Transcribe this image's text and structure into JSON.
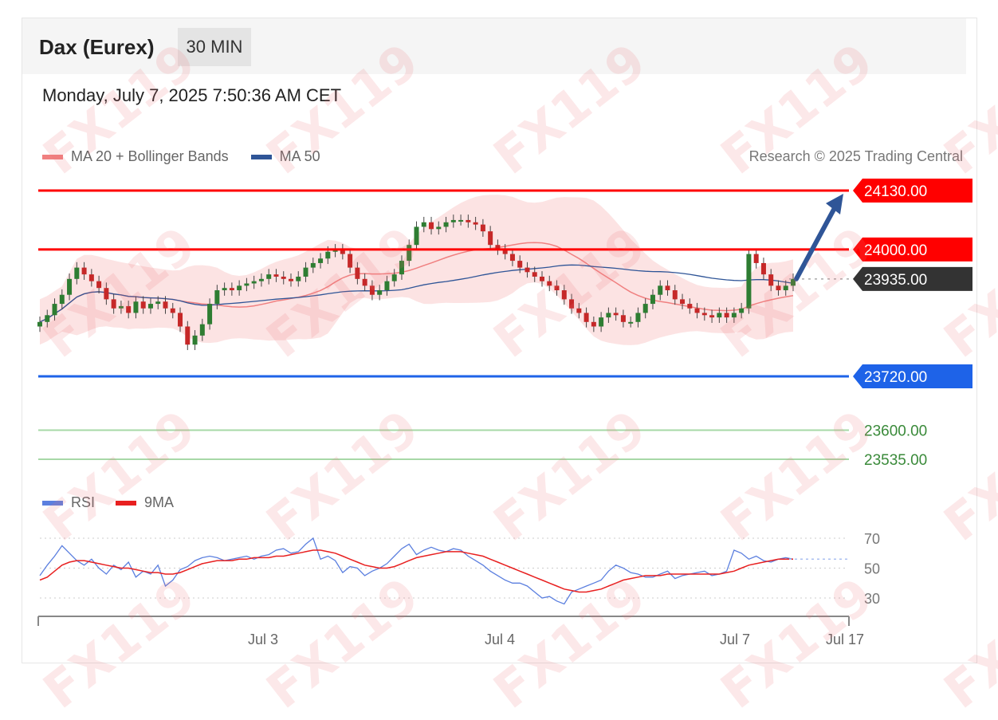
{
  "header": {
    "instrument": "Dax (Eurex)",
    "period": "30 MIN",
    "timestamp": "Monday, July 7, 2025 7:50:36 AM CET"
  },
  "legend_main": [
    {
      "label": "MA 20 + Bollinger Bands",
      "color": "#f08080"
    },
    {
      "label": "MA 50",
      "color": "#2f5597"
    }
  ],
  "legend_rsi": [
    {
      "label": "RSI",
      "color": "#5b7fdf"
    },
    {
      "label": "9MA",
      "color": "#e82020"
    }
  ],
  "credit": "Research © 2025 Trading Central",
  "watermark": "FX119",
  "colors": {
    "resistance": "#ff0000",
    "support": "#1e63e8",
    "target": "#3a8a3a",
    "last": "#333333",
    "arrow": "#2f5597",
    "bullish": "#2e7d32",
    "bearish": "#c62828"
  },
  "chart_data": [
    {
      "type": "candlestick",
      "title": "Dax (Eurex)",
      "timeframe": "30 MIN",
      "x_ticks": [
        "Jul 3",
        "Jul 4",
        "Jul 7",
        "Jul 17"
      ],
      "ylim": [
        23460,
        24170
      ],
      "levels": [
        {
          "value": 24130.0,
          "label": "24130.00",
          "kind": "resistance"
        },
        {
          "value": 24000.0,
          "label": "24000.00",
          "kind": "resistance"
        },
        {
          "value": 23935.0,
          "label": "23935.00",
          "kind": "last"
        },
        {
          "value": 23720.0,
          "label": "23720.00",
          "kind": "support"
        },
        {
          "value": 23600.0,
          "label": "23600.00",
          "kind": "target"
        },
        {
          "value": 23535.0,
          "label": "23535.00",
          "kind": "target"
        }
      ],
      "forecast_arrow": {
        "from": 23935,
        "to": 24130
      },
      "close_series_approx": [
        23840,
        23855,
        23880,
        23900,
        23935,
        23960,
        23945,
        23930,
        23915,
        23890,
        23870,
        23875,
        23860,
        23885,
        23870,
        23880,
        23885,
        23870,
        23860,
        23830,
        23790,
        23810,
        23835,
        23880,
        23910,
        23915,
        23910,
        23920,
        23925,
        23930,
        23935,
        23945,
        23940,
        23935,
        23930,
        23940,
        23960,
        23970,
        23980,
        23995,
        24000,
        23990,
        23960,
        23935,
        23920,
        23900,
        23910,
        23930,
        23945,
        23975,
        24010,
        24050,
        24060,
        24045,
        24050,
        24060,
        24065,
        24065,
        24060,
        24055,
        24040,
        24010,
        24000,
        23990,
        23975,
        23960,
        23950,
        23940,
        23930,
        23920,
        23910,
        23890,
        23870,
        23860,
        23840,
        23830,
        23850,
        23860,
        23855,
        23840,
        23840,
        23860,
        23880,
        23900,
        23920,
        23910,
        23890,
        23880,
        23870,
        23860,
        23855,
        23850,
        23860,
        23850,
        23860,
        23870,
        23990,
        23970,
        23945,
        23920,
        23910,
        23920,
        23935
      ]
    },
    {
      "type": "line",
      "title": "RSI",
      "series": [
        {
          "name": "RSI"
        },
        {
          "name": "9MA"
        }
      ],
      "ylim": [
        20,
        75
      ],
      "y_ticks": [
        70,
        50,
        30
      ],
      "rsi_values": [
        45,
        52,
        58,
        65,
        60,
        55,
        52,
        56,
        50,
        46,
        52,
        49,
        54,
        44,
        48,
        46,
        52,
        38,
        42,
        49,
        51,
        55,
        57,
        58,
        57,
        55,
        56,
        57,
        58,
        56,
        58,
        59,
        62,
        63,
        60,
        61,
        66,
        70,
        56,
        58,
        55,
        47,
        51,
        50,
        45,
        48,
        50,
        53,
        58,
        63,
        66,
        59,
        62,
        64,
        62,
        61,
        63,
        62,
        58,
        55,
        52,
        48,
        45,
        42,
        40,
        40,
        38,
        34,
        30,
        31,
        28,
        26,
        34,
        36,
        38,
        40,
        42,
        48,
        52,
        50,
        47,
        46,
        44,
        44,
        46,
        48,
        43,
        45,
        46,
        47,
        48,
        45,
        46,
        48,
        62,
        60,
        56,
        58,
        55,
        54,
        56,
        57,
        56
      ],
      "ma_values": [
        42,
        44,
        48,
        52,
        54,
        55,
        55,
        54,
        53,
        52,
        51,
        50,
        50,
        49,
        48,
        47,
        47,
        46,
        46,
        47,
        49,
        51,
        53,
        54,
        55,
        55,
        55,
        56,
        56,
        57,
        57,
        57,
        58,
        58,
        59,
        60,
        61,
        62,
        62,
        61,
        60,
        58,
        56,
        54,
        52,
        51,
        50,
        50,
        51,
        53,
        55,
        57,
        58,
        59,
        60,
        61,
        61,
        61,
        60,
        59,
        58,
        56,
        54,
        52,
        50,
        48,
        46,
        44,
        42,
        40,
        38,
        36,
        35,
        34,
        34,
        35,
        36,
        38,
        40,
        42,
        43,
        44,
        45,
        45,
        45,
        46,
        46,
        46,
        46,
        46,
        46,
        46,
        46,
        47,
        48,
        50,
        52,
        53,
        54,
        55,
        56,
        56,
        56
      ]
    }
  ]
}
